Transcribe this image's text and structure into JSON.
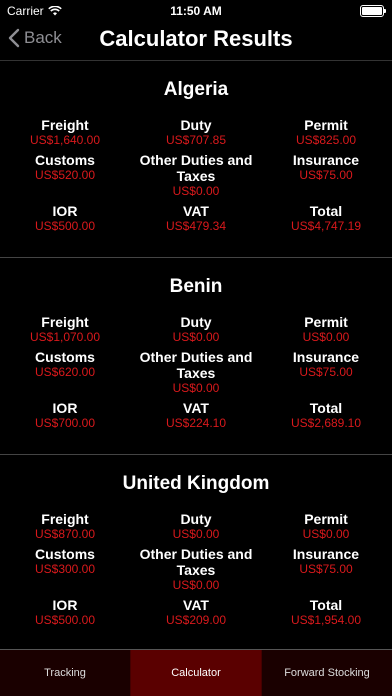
{
  "status": {
    "carrier": "Carrier",
    "time": "11:50 AM",
    "battery_level": 1.0
  },
  "nav": {
    "back_label": "Back",
    "title": "Calculator Results"
  },
  "countries": [
    {
      "name": "Algeria",
      "freight_label": "Freight",
      "freight": "US$1,640.00",
      "duty_label": "Duty",
      "duty": "US$707.85",
      "permit_label": "Permit",
      "permit": "US$825.00",
      "customs_label": "Customs",
      "customs": "US$520.00",
      "other_label": "Other Duties and Taxes",
      "other": "US$0.00",
      "insurance_label": "Insurance",
      "insurance": "US$75.00",
      "ior_label": "IOR",
      "ior": "US$500.00",
      "vat_label": "VAT",
      "vat": "US$479.34",
      "total_label": "Total",
      "total": "US$4,747.19"
    },
    {
      "name": "Benin",
      "freight_label": "Freight",
      "freight": "US$1,070.00",
      "duty_label": "Duty",
      "duty": "US$0.00",
      "permit_label": "Permit",
      "permit": "US$0.00",
      "customs_label": "Customs",
      "customs": "US$620.00",
      "other_label": "Other Duties and Taxes",
      "other": "US$0.00",
      "insurance_label": "Insurance",
      "insurance": "US$75.00",
      "ior_label": "IOR",
      "ior": "US$700.00",
      "vat_label": "VAT",
      "vat": "US$224.10",
      "total_label": "Total",
      "total": "US$2,689.10"
    },
    {
      "name": "United Kingdom",
      "freight_label": "Freight",
      "freight": "US$870.00",
      "duty_label": "Duty",
      "duty": "US$0.00",
      "permit_label": "Permit",
      "permit": "US$0.00",
      "customs_label": "Customs",
      "customs": "US$300.00",
      "other_label": "Other Duties and Taxes",
      "other": "US$0.00",
      "insurance_label": "Insurance",
      "insurance": "US$75.00",
      "ior_label": "IOR",
      "ior": "US$500.00",
      "vat_label": "VAT",
      "vat": "US$209.00",
      "total_label": "Total",
      "total": "US$1,954.00"
    }
  ],
  "tabs": [
    {
      "label": "Tracking",
      "active": false
    },
    {
      "label": "Calculator",
      "active": true
    },
    {
      "label": "Forward Stocking",
      "active": false
    }
  ],
  "colors": {
    "accent": "#d9191c",
    "tab_active": "#5a0000",
    "tab_bg": "#1a0000"
  }
}
